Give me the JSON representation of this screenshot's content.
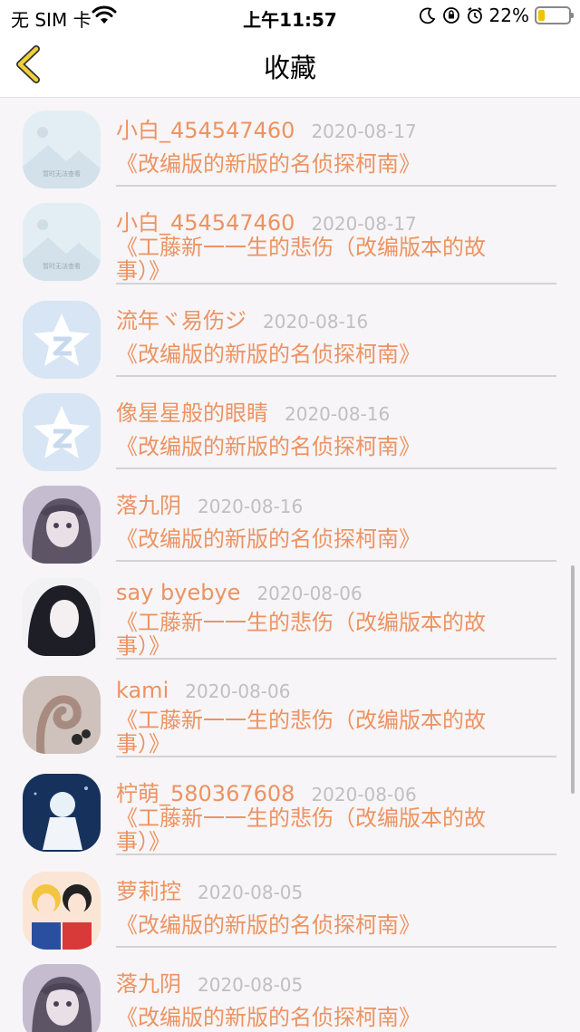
{
  "status": {
    "carrier": "无 SIM 卡",
    "time": "上午11:57",
    "battery": "22%",
    "battery_level": 0.22,
    "icons": [
      "wifi-icon",
      "moon-icon",
      "orientation-lock-icon",
      "alarm-icon"
    ]
  },
  "nav": {
    "title": "收藏",
    "back_icon": "chevron-left-icon",
    "accent": "#f1cf3a"
  },
  "colors": {
    "name": "#ec9362",
    "date": "#c0c0c0",
    "separator": "#d3d3d3"
  },
  "favorites": [
    {
      "user": "小白_454547460",
      "date": "2020-08-17",
      "title": "《改编版的新版的名侦探柯南》",
      "avatar": "placeholder-image"
    },
    {
      "user": "小白_454547460",
      "date": "2020-08-17",
      "title": "《工藤新一一生的悲伤（改编版本的故事）》",
      "avatar": "placeholder-image"
    },
    {
      "user": "流年ヾ易伤ジ",
      "date": "2020-08-16",
      "title": "《改编版的新版的名侦探柯南》",
      "avatar": "qq-default-avatar"
    },
    {
      "user": "像星星般的眼睛",
      "date": "2020-08-16",
      "title": "《改编版的新版的名侦探柯南》",
      "avatar": "qq-default-avatar"
    },
    {
      "user": "落九阴",
      "date": "2020-08-16",
      "title": "《改编版的新版的名侦探柯南》",
      "avatar": "anime-girl-photo"
    },
    {
      "user": "say byebye",
      "date": "2020-08-06",
      "title": "《工藤新一一生的悲伤（改编版本的故事）》",
      "avatar": "dark-hair-illustration"
    },
    {
      "user": "kami",
      "date": "2020-08-06",
      "title": "《工藤新一一生的悲伤（改编版本的故事）》",
      "avatar": "hand-gesture-photo"
    },
    {
      "user": "柠萌_580367608",
      "date": "2020-08-06",
      "title": "《工藤新一一生的悲伤（改编版本的故事）》",
      "avatar": "blue-anime-illustration"
    },
    {
      "user": "萝莉控",
      "date": "2020-08-05",
      "title": "《改编版的新版的名侦探柯南》",
      "avatar": "anime-girls-illustration"
    },
    {
      "user": "落九阴",
      "date": "2020-08-05",
      "title": "《改编版的新版的名侦探柯南》",
      "avatar": "anime-girl-photo"
    }
  ]
}
